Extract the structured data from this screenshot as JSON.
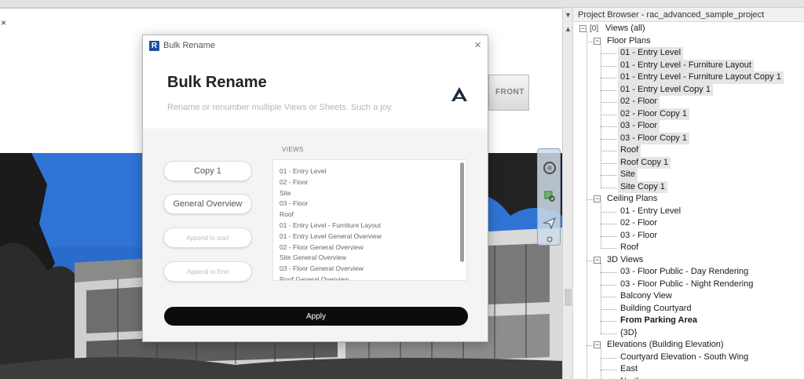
{
  "viewport": {
    "close_glyph": "×",
    "viewcube_label": "FRONT"
  },
  "splitter": {
    "menu_glyph": "▼",
    "up_glyph": "▲"
  },
  "project_browser": {
    "title": "Project Browser - rac_advanced_sample_project",
    "root": "Views (all)",
    "groups": [
      {
        "label": "Floor Plans",
        "items": [
          {
            "label": "01 - Entry Level",
            "selected": true
          },
          {
            "label": "01 - Entry Level - Furniture Layout",
            "selected": true
          },
          {
            "label": "01 - Entry Level - Furniture Layout Copy 1",
            "selected": true
          },
          {
            "label": "01 - Entry Level Copy 1",
            "selected": true
          },
          {
            "label": "02 - Floor",
            "selected": true
          },
          {
            "label": "02 - Floor Copy 1",
            "selected": true
          },
          {
            "label": "03 - Floor",
            "selected": true
          },
          {
            "label": "03 - Floor Copy 1",
            "selected": true
          },
          {
            "label": "Roof",
            "selected": true
          },
          {
            "label": "Roof Copy 1",
            "selected": true
          },
          {
            "label": "Site",
            "selected": true
          },
          {
            "label": "Site Copy 1",
            "selected": true
          }
        ]
      },
      {
        "label": "Ceiling Plans",
        "items": [
          {
            "label": "01 - Entry Level",
            "selected": false
          },
          {
            "label": "02 - Floor",
            "selected": false
          },
          {
            "label": "03 - Floor",
            "selected": false
          },
          {
            "label": "Roof",
            "selected": false
          }
        ]
      },
      {
        "label": "3D Views",
        "items": [
          {
            "label": "03 - Floor Public - Day Rendering",
            "selected": false
          },
          {
            "label": "03 - Floor Public - Night Rendering",
            "selected": false
          },
          {
            "label": "Balcony View",
            "selected": false
          },
          {
            "label": "Building Courtyard",
            "selected": false
          },
          {
            "label": "From Parking Area",
            "selected": false,
            "bold": true
          },
          {
            "label": "{3D}",
            "selected": false
          }
        ]
      },
      {
        "label": "Elevations (Building Elevation)",
        "items": [
          {
            "label": "Courtyard Elevation - South Wing",
            "selected": false
          },
          {
            "label": "East",
            "selected": false
          },
          {
            "label": "North",
            "selected": false
          }
        ]
      }
    ]
  },
  "dialog": {
    "window_title": "Bulk Rename",
    "close_glyph": "×",
    "logo_letter": "R",
    "heading": "Bulk Rename",
    "subtitle": "Rename or renumber multiple Views or Sheets. Such a joy.",
    "find_value": "Copy 1",
    "replace_value": "General Overview",
    "append_start_placeholder": "Append to start",
    "append_end_placeholder": "Append to End",
    "views_label": "VIEWS",
    "views": [
      "01 - Entry Level",
      "02 - Floor",
      "Site",
      "03 - Floor",
      "Roof",
      "01 - Entry Level - Furniture Layout",
      "01 - Entry Level General Overview",
      "02 - Floor General Overview",
      "Site General Overview",
      "03 - Floor General Overview",
      "Roof General Overview"
    ],
    "apply_label": "Apply"
  }
}
